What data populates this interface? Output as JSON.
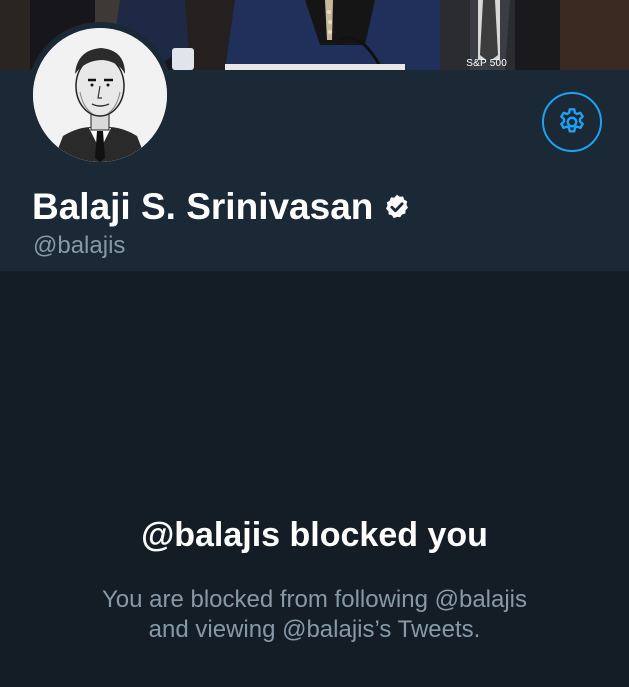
{
  "banner": {
    "caption": "S&P 500"
  },
  "profile": {
    "display_name": "Balaji S. Srinivasan",
    "handle": "@balajis",
    "verified": true,
    "avatar_icon": "avatar-illustration"
  },
  "actions": {
    "settings_icon": "gear-icon"
  },
  "blocked": {
    "title": "@balajis blocked you",
    "description_line1": "You are blocked from following @balajis",
    "description_line2": "and viewing @balajis’s Tweets."
  },
  "colors": {
    "background": "#141d26",
    "header_background": "#1b2836",
    "accent": "#1da1f2",
    "secondary_text": "#8899a6"
  }
}
